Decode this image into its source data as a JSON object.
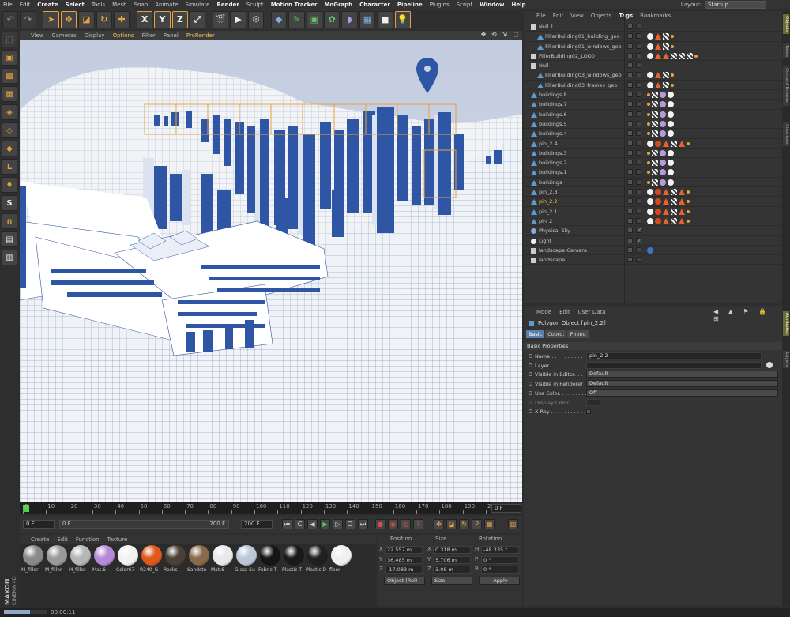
{
  "menubar": {
    "items": [
      "File",
      "Edit",
      "Create",
      "Select",
      "Tools",
      "Mesh",
      "Snap",
      "Animate",
      "Simulate",
      "Render",
      "Sculpt",
      "Motion Tracker",
      "MoGraph",
      "Character",
      "Pipeline",
      "Plugins",
      "Script",
      "Window",
      "Help"
    ],
    "highlighted": [
      "Create",
      "Select",
      "Render",
      "Motion Tracker",
      "MoGraph",
      "Character",
      "Pipeline",
      "Window",
      "Help"
    ],
    "layout_label": "Layout:",
    "layout_value": "Startup"
  },
  "viewport": {
    "menu": [
      "View",
      "Cameras",
      "Display",
      "Options",
      "Filter",
      "Panel",
      "ProRender"
    ],
    "active": [
      "Options",
      "ProRender"
    ],
    "nav_icons": "✥ ⟲ ⇲ ⬚"
  },
  "timeline": {
    "ticks": [
      "0",
      "10",
      "20",
      "30",
      "40",
      "50",
      "60",
      "70",
      "80",
      "90",
      "100",
      "110",
      "120",
      "130",
      "140",
      "150",
      "160",
      "170",
      "180",
      "190",
      "200"
    ],
    "current_frame": "0 F",
    "start_field": "0 F",
    "range_start": "0 F",
    "range_end": "200 F",
    "end_field": "200 F"
  },
  "material_manager": {
    "menu": [
      "Create",
      "Edit",
      "Function",
      "Texture"
    ],
    "materials": [
      {
        "name": "M_filler",
        "color": "#8a8a8a"
      },
      {
        "name": "M_filler",
        "color": "#9a9a9a"
      },
      {
        "name": "M_filler",
        "color": "#b6b6b6"
      },
      {
        "name": "Mat.6",
        "color": "#b58ad8"
      },
      {
        "name": "Color67",
        "color": "#f2f2f2"
      },
      {
        "name": "R240_G",
        "color": "#e0581c"
      },
      {
        "name": "Rocks",
        "color": "#4a4038"
      },
      {
        "name": "Sandsto",
        "color": "#8a6a4a"
      },
      {
        "name": "Mat.6",
        "color": "#e8e8e8"
      },
      {
        "name": "Glass Su",
        "color": "#bcc8d8"
      },
      {
        "name": "Fabric T",
        "color": "#151515"
      },
      {
        "name": "Plastic T",
        "color": "#1a1a1a"
      },
      {
        "name": "Plastic D",
        "color": "#202020"
      },
      {
        "name": "floor",
        "color": "#f0f0f0"
      }
    ],
    "brand_line1": "MAXON",
    "brand_line2": "CINEMA 4D"
  },
  "coordinates": {
    "headers": [
      "Position",
      "Size",
      "Rotation"
    ],
    "rows": [
      {
        "axis": "X",
        "pos": "22.557 m",
        "size_axis": "X",
        "size": "0.318 m",
        "rot_axis": "H",
        "rot": "-48.335 °"
      },
      {
        "axis": "Y",
        "pos": "36.485 m",
        "size_axis": "Y",
        "size": "5.706 m",
        "rot_axis": "P",
        "rot": "0 °"
      },
      {
        "axis": "Z",
        "pos": "-17.083 m",
        "size_axis": "Z",
        "size": "3.08 m",
        "rot_axis": "B",
        "rot": "0 °"
      }
    ],
    "mode1": "Object (Rel)",
    "mode2": "Size",
    "apply": "Apply"
  },
  "status": {
    "time": "00:00:11",
    "progress": 0.6
  },
  "object_manager": {
    "menu": [
      "File",
      "Edit",
      "View",
      "Objects",
      "Tags",
      "Bookmarks"
    ],
    "active": "Tags",
    "rows": [
      {
        "name": "Null.1",
        "indent": 0,
        "icon": "null",
        "tags": ""
      },
      {
        "name": "FillerBuilding01_building_geo",
        "indent": 1,
        "icon": "poly",
        "tags": "wb,or,ck,dt"
      },
      {
        "name": "FillerBuilding01_windows_geo",
        "indent": 1,
        "icon": "poly",
        "tags": "wb,or,ck,dt"
      },
      {
        "name": "FillerBuilding02_LOD0",
        "indent": 0,
        "icon": "null",
        "tags": "wb,or,or,ck,ck,ck,dt"
      },
      {
        "name": "Null",
        "indent": 0,
        "icon": "null",
        "tags": ""
      },
      {
        "name": "FillerBuilding03_windows_geo",
        "indent": 1,
        "icon": "poly",
        "tags": "wb,or,ck,dt"
      },
      {
        "name": "FillerBuilding03_frames_geo",
        "indent": 1,
        "icon": "poly",
        "tags": "wb,or,ck,dt"
      },
      {
        "name": "buildings.8",
        "indent": 0,
        "icon": "poly",
        "tags": "dt,ck,pb,wb"
      },
      {
        "name": "buildings.7",
        "indent": 0,
        "icon": "poly",
        "tags": "dt,ck,pb,wb"
      },
      {
        "name": "buildings.6",
        "indent": 0,
        "icon": "poly",
        "tags": "dt,ck,pb,wb"
      },
      {
        "name": "buildings.5",
        "indent": 0,
        "icon": "poly",
        "tags": "dt,ck,pb,wb"
      },
      {
        "name": "buildings.4",
        "indent": 0,
        "icon": "poly",
        "tags": "dt,ck,pb,wb"
      },
      {
        "name": "pin_2.4",
        "indent": 0,
        "icon": "poly",
        "tags": "wb,rb,or,ck,or,dt"
      },
      {
        "name": "buildings.3",
        "indent": 0,
        "icon": "poly",
        "tags": "dt,ck,pb,wb"
      },
      {
        "name": "buildings.2",
        "indent": 0,
        "icon": "poly",
        "tags": "dt,ck,pb,wb"
      },
      {
        "name": "buildings.1",
        "indent": 0,
        "icon": "poly",
        "tags": "dt,ck,pb,wb"
      },
      {
        "name": "buildings",
        "indent": 0,
        "icon": "poly",
        "tags": "dt,ck,pb,wb"
      },
      {
        "name": "pin_2.3",
        "indent": 0,
        "icon": "poly",
        "tags": "wb,rb,or,ck,or,dt"
      },
      {
        "name": "pin_2.2",
        "indent": 0,
        "icon": "poly",
        "tags": "wb,rb,or,ck,or,dt",
        "selected": true
      },
      {
        "name": "pin_2.1",
        "indent": 0,
        "icon": "poly",
        "tags": "wb,rb,or,ck,or,dt"
      },
      {
        "name": "pin_2",
        "indent": 0,
        "icon": "poly",
        "tags": "wb,rb,or,ck,or,dt"
      },
      {
        "name": "Physical Sky",
        "indent": 0,
        "icon": "sky",
        "tags": ""
      },
      {
        "name": "Light",
        "indent": 0,
        "icon": "light",
        "tags": ""
      },
      {
        "name": "landscape-Camera",
        "indent": 0,
        "icon": "cam",
        "tags": "bl"
      },
      {
        "name": "landscape",
        "indent": 0,
        "icon": "null",
        "tags": ""
      }
    ]
  },
  "attribute_manager": {
    "menu": [
      "Mode",
      "Edit",
      "User Data"
    ],
    "title": "Polygon Object [pin_2.2]",
    "tabs": [
      "Basic",
      "Coord.",
      "Phong"
    ],
    "active_tab": "Basic",
    "section": "Basic Properties",
    "props": [
      {
        "label": "Name . . . . . . . . . . . .",
        "value": "pin_2.2",
        "kind": "text"
      },
      {
        "label": "Layer . . . . . . . . . . . .",
        "value": "",
        "kind": "layer"
      },
      {
        "label": "Visible in Editor. . .",
        "value": "Default",
        "kind": "dd"
      },
      {
        "label": "Visible in Renderer",
        "value": "Default",
        "kind": "dd"
      },
      {
        "label": "Use Color. . . . . . . . .",
        "value": "Off",
        "kind": "dd"
      },
      {
        "label": "Display Color. . . . . . .",
        "value": "",
        "kind": "color"
      },
      {
        "label": "X-Ray . . . . . . . . . . . .",
        "value": "",
        "kind": "check"
      }
    ]
  },
  "right_tabs": [
    "Objects",
    "Takes",
    "Content Browser",
    "Structure",
    "Attributes",
    "Layers"
  ]
}
